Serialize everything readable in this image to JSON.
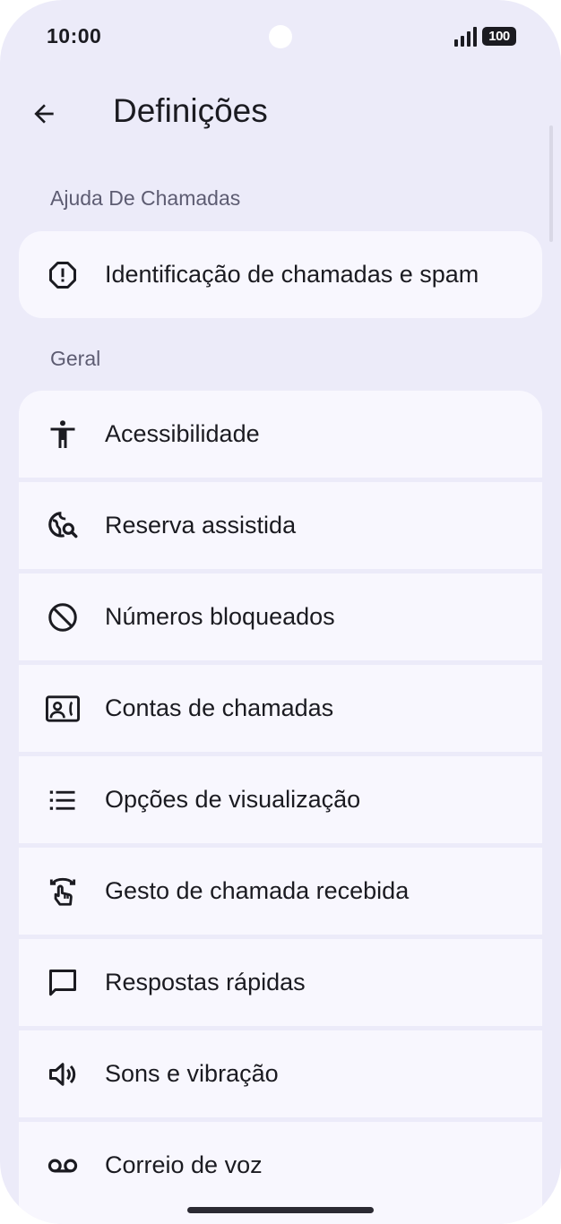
{
  "status_bar": {
    "time": "10:00",
    "battery": "100"
  },
  "app_bar": {
    "title": "Definições",
    "back_icon": "arrow-back-icon"
  },
  "sections": [
    {
      "header": "Ajuda De Chamadas",
      "items": [
        {
          "label": "Identificação de chamadas e spam",
          "icon": "alert-octagon-icon"
        }
      ]
    },
    {
      "header": "Geral",
      "items": [
        {
          "label": "Acessibilidade",
          "icon": "accessibility-icon"
        },
        {
          "label": "Reserva assistida",
          "icon": "travel-explore-icon"
        },
        {
          "label": "Números bloqueados",
          "icon": "block-icon"
        },
        {
          "label": "Contas de chamadas",
          "icon": "contact-phone-icon"
        },
        {
          "label": "Opções de visualização",
          "icon": "list-icon"
        },
        {
          "label": "Gesto de chamada recebida",
          "icon": "swipe-gesture-icon"
        },
        {
          "label": "Respostas rápidas",
          "icon": "chat-bubble-icon"
        },
        {
          "label": "Sons e vibração",
          "icon": "volume-icon"
        },
        {
          "label": "Correio de voz",
          "icon": "voicemail-icon"
        }
      ]
    }
  ],
  "colors": {
    "background": "#ecebf9",
    "card": "#f8f7fe",
    "text": "#1b1b21",
    "section_header": "#5d5c72"
  }
}
